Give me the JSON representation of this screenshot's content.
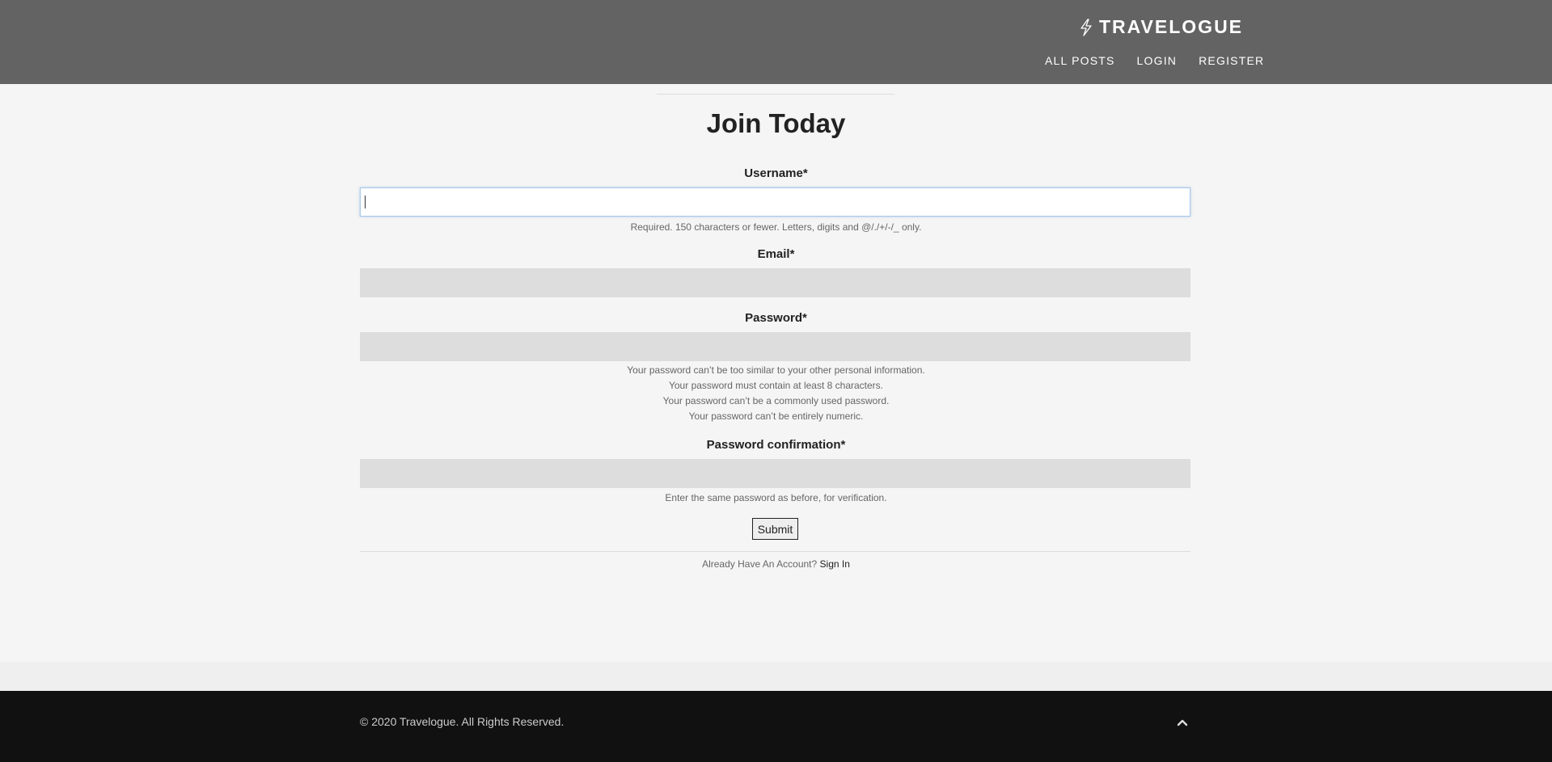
{
  "header": {
    "brand": "TRAVELOGUE",
    "brand_icon": "lightning-bolt-icon",
    "nav": [
      "ALL POSTS",
      "LOGIN",
      "REGISTER"
    ]
  },
  "form": {
    "title": "Join Today",
    "username": {
      "label": "Username*",
      "value": "",
      "help": "Required. 150 characters or fewer. Letters, digits and @/./+/-/_ only."
    },
    "email": {
      "label": "Email*",
      "value": ""
    },
    "password": {
      "label": "Password*",
      "value": "",
      "help": [
        "Your password can’t be too similar to your other personal information.",
        "Your password must contain at least 8 characters.",
        "Your password can’t be a commonly used password.",
        "Your password can’t be entirely numeric."
      ]
    },
    "password_confirmation": {
      "label": "Password confirmation*",
      "value": "",
      "help": "Enter the same password as before, for verification."
    },
    "submit_label": "Submit",
    "already_text": "Already Have An Account?",
    "signin_link": "Sign In"
  },
  "footer": {
    "copyright": "© 2020 Travelogue. All Rights Reserved.",
    "to_top_icon": "chevron-up-icon"
  },
  "colors": {
    "header_bg": "#636363",
    "footer_bg": "#111111",
    "page_bg": "#f5f5f5",
    "input_bg": "#dddddd"
  }
}
